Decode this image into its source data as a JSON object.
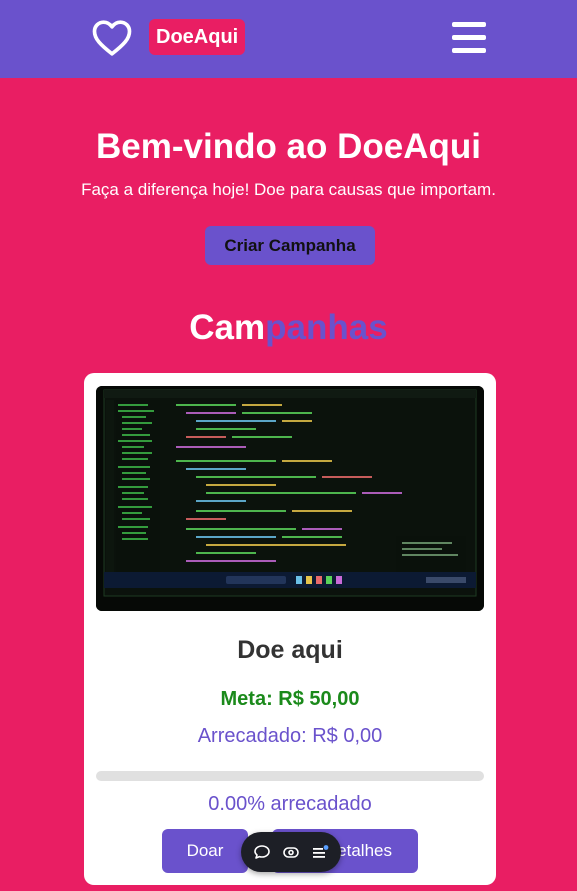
{
  "header": {
    "brand": "DoeAqui",
    "icons": [
      "heart-icon",
      "menu-icon"
    ]
  },
  "hero": {
    "title": "Bem-vindo ao DoeAqui",
    "subtitle": "Faça a diferença hoje! Doe para causas que importam.",
    "cta_label": "Criar Campanha"
  },
  "section": {
    "title_part1": "Cam",
    "title_part2": "panhas"
  },
  "campaigns": [
    {
      "title": "Doe aqui",
      "goal": "Meta: R$ 50,00",
      "raised": "Arrecadado: R$ 0,00",
      "progress_fraction": 0,
      "progress_label": "0.00% arrecadado",
      "donate_label": "Doar",
      "details_label": "Detalhes"
    }
  ],
  "toolbar": {
    "icons": [
      "chat-icon",
      "eye-icon",
      "list-icon"
    ]
  },
  "colors": {
    "brand_purple": "#6a52cc",
    "brand_pink": "#e91e63",
    "goal_green": "#1b8a1b"
  }
}
